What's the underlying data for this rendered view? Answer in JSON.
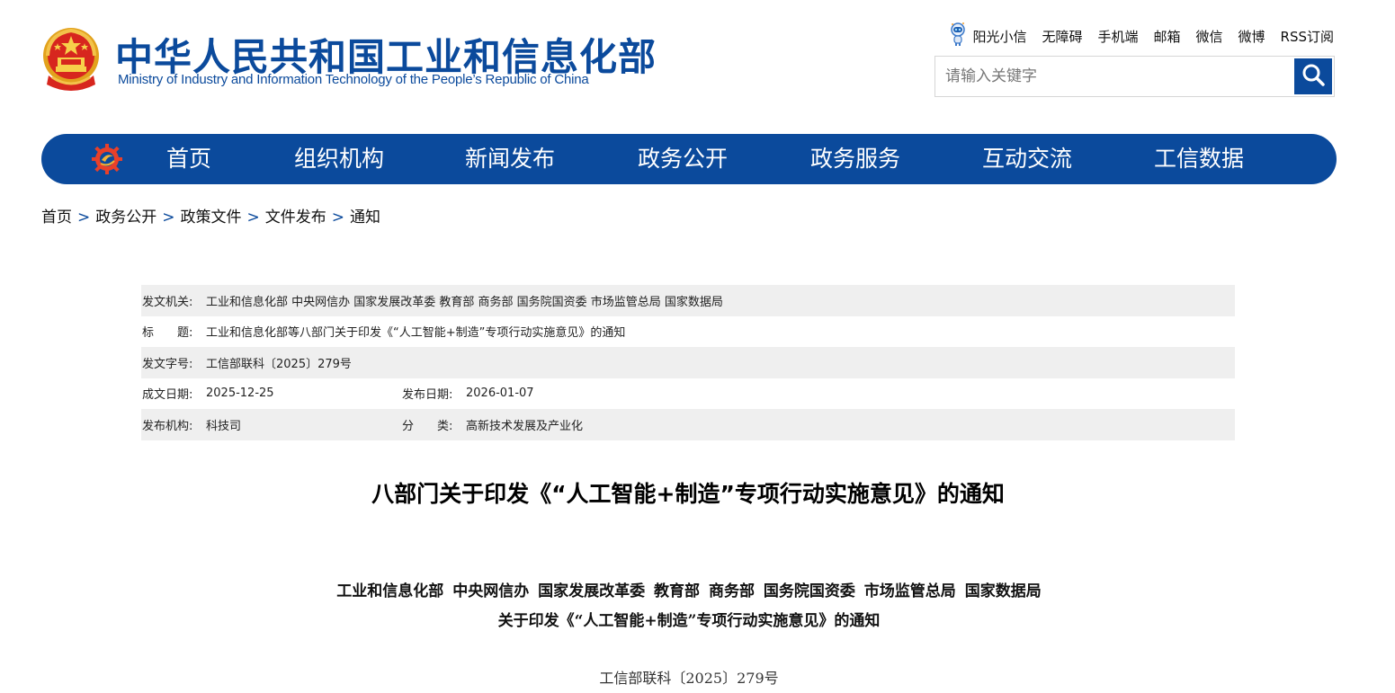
{
  "header": {
    "logo_cn": "中华人民共和国工业和信息化部",
    "logo_en": "Ministry of Industry and Information Technology of the People’s Republic of China",
    "top_links": [
      "阳光小信",
      "无障碍",
      "手机端",
      "邮箱",
      "微信",
      "微博",
      "RSS订阅"
    ],
    "search_placeholder": "请输入关键字"
  },
  "nav": {
    "items": [
      "首页",
      "组织机构",
      "新闻发布",
      "政务公开",
      "政务服务",
      "互动交流",
      "工信数据"
    ]
  },
  "breadcrumb": [
    "首页",
    "政务公开",
    "政策文件",
    "文件发布",
    "通知"
  ],
  "breadcrumb_sep": ">",
  "meta": {
    "issuer_label": "发文机关:",
    "issuer": "工业和信息化部 中央网信办 国家发展改革委 教育部 商务部 国务院国资委 市场监管总局 国家数据局",
    "title_label": "标　　题:",
    "title": "工业和信息化部等八部门关于印发《“人工智能+制造”专项行动实施意见》的通知",
    "doc_no_label": "发文字号:",
    "doc_no": "工信部联科〔2025〕279号",
    "written_label": "成文日期:",
    "written_date": "2025-12-25",
    "published_label": "发布日期:",
    "published_date": "2026-01-07",
    "org_label": "发布机构:",
    "org": "科技司",
    "category_label": "分　　类:",
    "category": "高新技术发展及产业化"
  },
  "article": {
    "title": "八部门关于印发《“人工智能+制造”专项行动实施意见》的通知",
    "issuers": "工业和信息化部 中央网信办 国家发展改革委 教育部 商务部 国务院国资委 市场监管总局 国家数据局",
    "subtitle": "关于印发《“人工智能+制造”专项行动实施意见》的通知",
    "doc_number": "工信部联科〔2025〕279号"
  },
  "colors": {
    "brand_blue": "#0b4a9c",
    "meta_shade": "#efefef"
  },
  "icons": {
    "emblem": "national-emblem-icon",
    "robot": "robot-icon",
    "search": "search-icon",
    "nav_logo": "miit-gear-logo-icon"
  }
}
